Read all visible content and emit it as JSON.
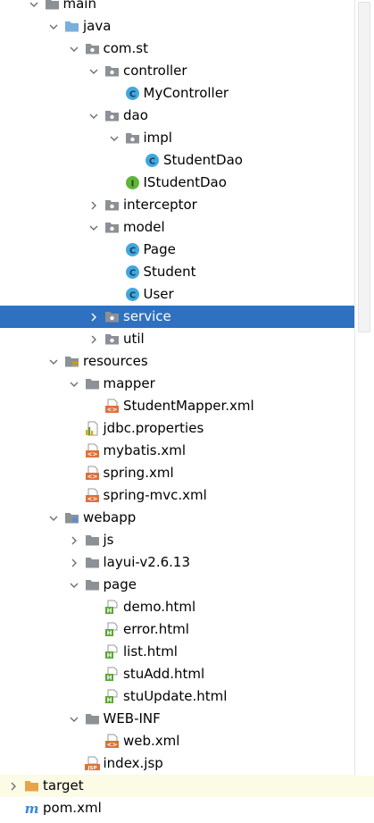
{
  "tree": [
    {
      "label": "main",
      "depth": 1,
      "arrow": "down",
      "icon": "folder-gray"
    },
    {
      "label": "java",
      "depth": 2,
      "arrow": "down",
      "icon": "folder-blue"
    },
    {
      "label": "com.st",
      "depth": 3,
      "arrow": "down",
      "icon": "package"
    },
    {
      "label": "controller",
      "depth": 4,
      "arrow": "down",
      "icon": "package"
    },
    {
      "label": "MyController",
      "depth": 5,
      "arrow": "none",
      "icon": "class"
    },
    {
      "label": "dao",
      "depth": 4,
      "arrow": "down",
      "icon": "package"
    },
    {
      "label": "impl",
      "depth": 5,
      "arrow": "down",
      "icon": "package"
    },
    {
      "label": "StudentDao",
      "depth": 6,
      "arrow": "none",
      "icon": "class"
    },
    {
      "label": "IStudentDao",
      "depth": 5,
      "arrow": "none",
      "icon": "interface"
    },
    {
      "label": "interceptor",
      "depth": 4,
      "arrow": "right",
      "icon": "package"
    },
    {
      "label": "model",
      "depth": 4,
      "arrow": "down",
      "icon": "package"
    },
    {
      "label": "Page",
      "depth": 5,
      "arrow": "none",
      "icon": "class"
    },
    {
      "label": "Student",
      "depth": 5,
      "arrow": "none",
      "icon": "class"
    },
    {
      "label": "User",
      "depth": 5,
      "arrow": "none",
      "icon": "class"
    },
    {
      "label": "service",
      "depth": 4,
      "arrow": "right",
      "icon": "package",
      "selected": true
    },
    {
      "label": "util",
      "depth": 4,
      "arrow": "right",
      "icon": "package"
    },
    {
      "label": "resources",
      "depth": 2,
      "arrow": "down",
      "icon": "folder-resources"
    },
    {
      "label": "mapper",
      "depth": 3,
      "arrow": "down",
      "icon": "folder-gray"
    },
    {
      "label": "StudentMapper.xml",
      "depth": 4,
      "arrow": "none",
      "icon": "xml"
    },
    {
      "label": "jdbc.properties",
      "depth": 3,
      "arrow": "none",
      "icon": "properties"
    },
    {
      "label": "mybatis.xml",
      "depth": 3,
      "arrow": "none",
      "icon": "xml"
    },
    {
      "label": "spring.xml",
      "depth": 3,
      "arrow": "none",
      "icon": "xml"
    },
    {
      "label": "spring-mvc.xml",
      "depth": 3,
      "arrow": "none",
      "icon": "xml"
    },
    {
      "label": "webapp",
      "depth": 2,
      "arrow": "down",
      "icon": "folder-web"
    },
    {
      "label": "js",
      "depth": 3,
      "arrow": "right",
      "icon": "folder-gray"
    },
    {
      "label": "layui-v2.6.13",
      "depth": 3,
      "arrow": "right",
      "icon": "folder-gray"
    },
    {
      "label": "page",
      "depth": 3,
      "arrow": "down",
      "icon": "folder-gray"
    },
    {
      "label": "demo.html",
      "depth": 4,
      "arrow": "none",
      "icon": "html"
    },
    {
      "label": "error.html",
      "depth": 4,
      "arrow": "none",
      "icon": "html"
    },
    {
      "label": "list.html",
      "depth": 4,
      "arrow": "none",
      "icon": "html"
    },
    {
      "label": "stuAdd.html",
      "depth": 4,
      "arrow": "none",
      "icon": "html"
    },
    {
      "label": "stuUpdate.html",
      "depth": 4,
      "arrow": "none",
      "icon": "html"
    },
    {
      "label": "WEB-INF",
      "depth": 3,
      "arrow": "down",
      "icon": "folder-gray"
    },
    {
      "label": "web.xml",
      "depth": 4,
      "arrow": "none",
      "icon": "xml"
    },
    {
      "label": "index.jsp",
      "depth": 3,
      "arrow": "none",
      "icon": "jsp"
    },
    {
      "label": "target",
      "depth": 0,
      "arrow": "right",
      "icon": "folder-orange",
      "band": true
    },
    {
      "label": "pom.xml",
      "depth": 0,
      "arrow": "none",
      "icon": "maven"
    }
  ],
  "colors": {
    "selection": "#2f71c0",
    "class_icon": "#41a8de",
    "interface_icon": "#5fb53c",
    "xml_icon": "#e0703a",
    "html_icon": "#58a531",
    "folder_blue": "#7aaedf",
    "folder_gray": "#8c9196",
    "folder_orange": "#e8a449",
    "maven": "#3b88d6",
    "target_band": "#fbfbe6"
  }
}
